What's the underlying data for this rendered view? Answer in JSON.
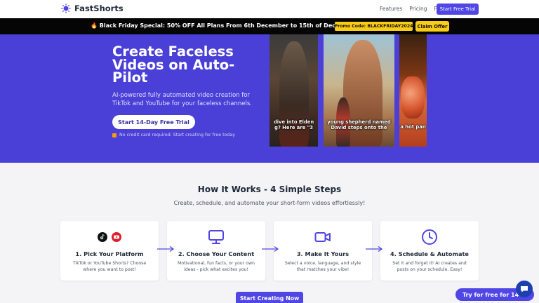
{
  "nav": {
    "logo_text": "FastShorts",
    "links": [
      "Features",
      "Pricing",
      "FAQ"
    ],
    "cta_label": "Start Free Trial"
  },
  "promo": {
    "icon": "fire-emoji",
    "text": "🔥 Black Friday Special: 50% OFF All Plans From 6th December to 15th of December!",
    "code_label": "Promo Code: BLACKFRIDAY2024",
    "claim_label": "Claim Offer"
  },
  "hero": {
    "title": "Create Faceless Videos on Auto-Pilot",
    "subtitle": "AI-powered fully automated video creation for TikTok and YouTube for your faceless channels.",
    "cta_label": "Start 14-Day Free Trial",
    "note": "No credit card required. Start creating for free today",
    "videos": [
      {
        "caption_line1": "dive into Elden",
        "caption_line2": "g? Here are \"3"
      },
      {
        "caption_line1": "young shepherd named",
        "caption_line2": "David steps onto the"
      },
      {
        "caption_line1": "a hot pan",
        "caption_line2": ""
      }
    ]
  },
  "how": {
    "title": "How It Works - 4 Simple Steps",
    "subtitle": "Create, schedule, and automate your short-form videos effortlessly!",
    "steps": [
      {
        "title": "1. Pick Your Platform",
        "desc": "TikTok or YouTube Shorts? Choose where you want to post!",
        "icons": [
          "tiktok-icon",
          "youtube-icon"
        ]
      },
      {
        "title": "2. Choose Your Content",
        "desc": "Motivational, fun facts, or your own ideas - pick what excites you!",
        "icons": [
          "monitor-icon"
        ]
      },
      {
        "title": "3. Make It Yours",
        "desc": "Select a voice, language, and style that matches your vibe!",
        "icons": [
          "video-camera-icon"
        ]
      },
      {
        "title": "4. Schedule & Automate",
        "desc": "Set it and forget it! AI creates and posts on your schedule. Easy!",
        "icons": [
          "clock-icon"
        ]
      }
    ],
    "cta_label": "Start Creating Now"
  },
  "floating": {
    "trial_label": "Try for free for 14 d",
    "chat_icon": "chat-icon"
  },
  "colors": {
    "brand": "#4f46e5",
    "hero_bg": "#4a3fd6",
    "promo_bg": "#050505",
    "promo_accent": "#facc15"
  }
}
